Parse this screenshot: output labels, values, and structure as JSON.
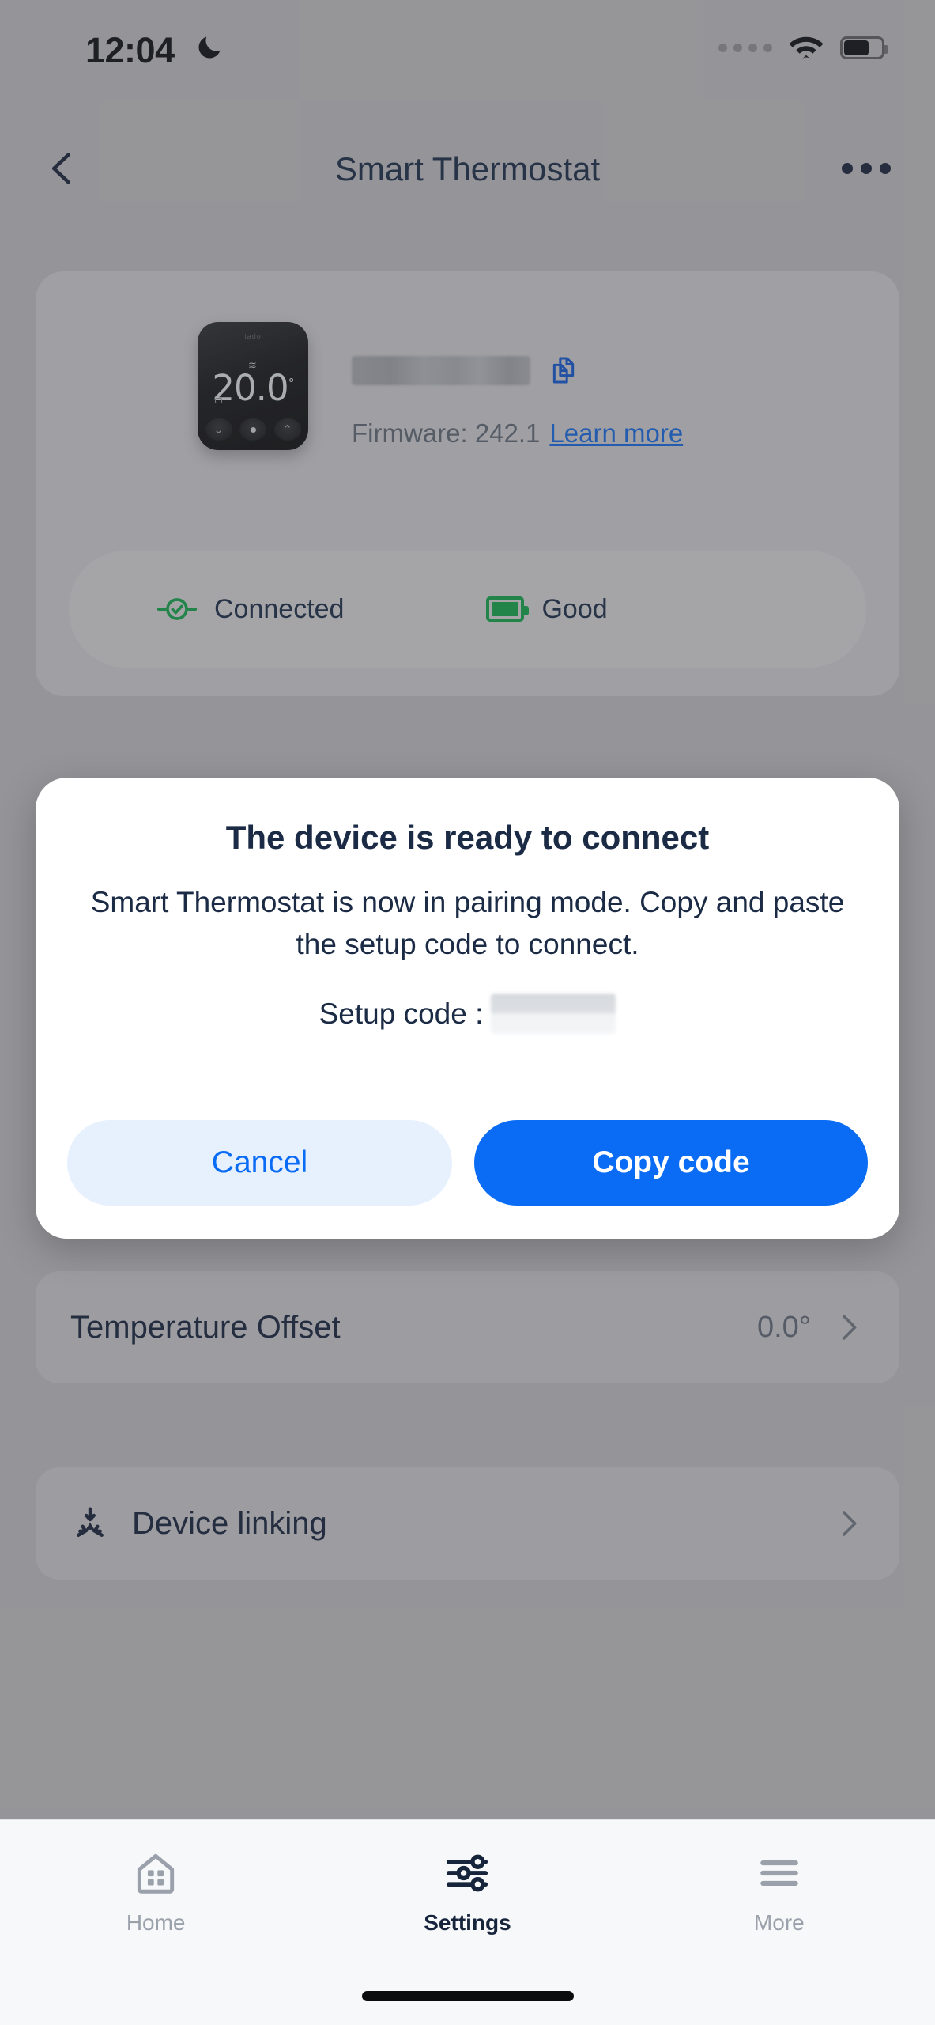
{
  "status_bar": {
    "time": "12:04",
    "dnd_icon": "crescent-moon-icon",
    "cellular_icon": "cellular-dots-icon",
    "wifi_icon": "wifi-icon",
    "battery_icon": "battery-icon"
  },
  "nav": {
    "back_icon": "chevron-left-icon",
    "title": "Smart Thermostat",
    "more_icon": "ellipsis-icon"
  },
  "device_card": {
    "thermostat_image": {
      "brand": "tado",
      "heat_icon": "heat-waves-icon",
      "temperature": "20.0",
      "degree": "°",
      "button_down_icon": "chevron-down-icon",
      "button_center_icon": "dot-icon",
      "button_up_icon": "chevron-up-icon"
    },
    "device_name_redacted": "",
    "copy_icon": "copy-icon",
    "firmware_label": "Firmware: 242.1",
    "learn_more": "Learn more",
    "status": {
      "connection_icon": "link-check-icon",
      "connection_text": "Connected",
      "battery_icon": "battery-good-icon",
      "battery_text": "Good"
    }
  },
  "modal": {
    "title": "The device is ready to connect",
    "body": "Smart Thermostat is now in pairing mode. Copy and paste the setup code to connect.",
    "code_label": "Setup code :",
    "code_value_redacted": "",
    "cancel_label": "Cancel",
    "copy_label": "Copy code"
  },
  "settings_rows": [
    {
      "label": "Temperature Offset",
      "value": "0.0°",
      "chevron_icon": "chevron-right-icon"
    },
    {
      "label": "Device linking",
      "icon": "device-linking-icon",
      "value": "",
      "chevron_icon": "chevron-right-icon"
    }
  ],
  "tabbar": {
    "items": [
      {
        "label": "Home",
        "icon": "home-icon",
        "active": false
      },
      {
        "label": "Settings",
        "icon": "sliders-icon",
        "active": true
      },
      {
        "label": "More",
        "icon": "hamburger-icon",
        "active": false
      }
    ]
  },
  "colors": {
    "primary_blue": "#0a6cf5",
    "link_blue": "#1565d8",
    "navy_text": "#1b2b45",
    "green_status": "#15a04a",
    "dim_overlay": "#a9a9ac"
  }
}
